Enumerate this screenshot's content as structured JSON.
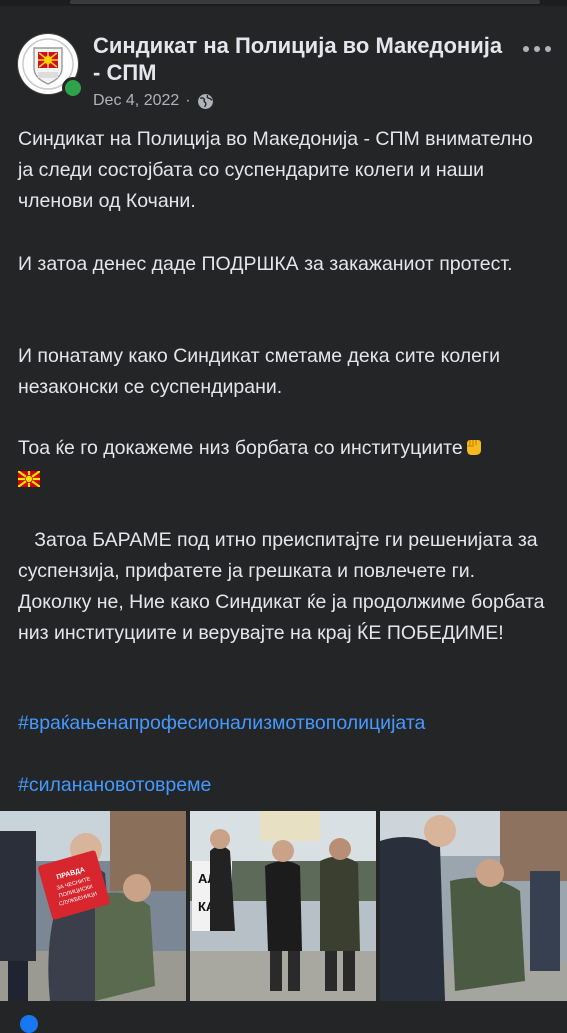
{
  "post": {
    "page_name": "Синдикат на Полиција во Македонија - СПМ",
    "date": "Dec 4, 2022",
    "separator": "·",
    "audience_icon": "globe-icon",
    "more_icon": "more-options-icon",
    "paragraphs": {
      "p1": "Синдикат на Полиција во Македонија - СПМ внимателно ја следи состојбата со суспендарите колеги и наши членови од Кочани.",
      "p2": "И затоа денес даде ПОДРШКА за закажаниот протест.",
      "p3": "И понатаму како Синдикат сметаме дека сите колеги незаконски се суспендирани.",
      "p4": "Тоа ќе го докажеме низ борбата со институциите",
      "p5": "   Затоа БАРАМЕ под итно преиспитајте ги решенијата за суспензија, прифатете ја грешката и повлечете ги. Доколку не, Ние како Синдикат ќе ја продолжиме борбата низ институциите и верувајте на крај ЌЕ ПОБЕДИМЕ!"
    },
    "hashtags": {
      "h1": "#враќањенапрофесионализмотвополицијата",
      "h2": "#силанановотовреме"
    },
    "emojis": [
      "fist-emoji",
      "north-macedonia-flag-emoji"
    ],
    "photo_sign_text": {
      "left": "ПРАВДА ЗА ЧЕСНИТЕ ПОЛИЦИСКИ СЛУЖБЕНИЦИ",
      "middle": "АЛ КА"
    },
    "colors": {
      "background": "#242526",
      "text": "#e4e6eb",
      "secondary": "#b0b3b8",
      "hashtag": "#4599ff",
      "online": "#31a24c"
    }
  }
}
